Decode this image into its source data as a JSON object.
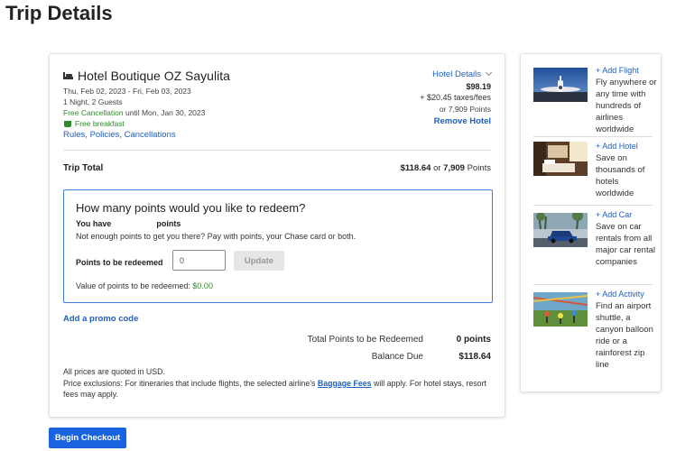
{
  "page": {
    "title": "Trip Details"
  },
  "hotel": {
    "name": "Hotel Boutique OZ Sayulita",
    "dates": "Thu, Feb 02, 2023 - Fri, Feb 03, 2023",
    "guests": "1 Night, 2 Guests",
    "free_cancel": "Free Cancellation",
    "cancel_until": " until Mon, Jan 30, 2023",
    "breakfast": "Free breakfast",
    "rules_link": "Rules, Policies, Cancellations",
    "details_link": "Hotel Details",
    "price": "$98.19",
    "taxes": "+ $20.45 taxes/fees",
    "points": "or 7,909 Points",
    "remove": "Remove Hotel"
  },
  "trip_total": {
    "label": "Trip Total",
    "amount": "$118.64",
    "or": " or ",
    "points": "7,909",
    "points_suffix": " Points"
  },
  "redeem": {
    "title": "How many points would you like to redeem?",
    "you_have": "You have",
    "points_word": "points",
    "not_enough": "Not enough points to get you there? Pay with points, your Chase card or both.",
    "input_label": "Points to be redeemed",
    "input_value": "0",
    "update_label": "Update",
    "value_label": "Value of points to be redeemed: ",
    "value_amount": "$0.00"
  },
  "promo": {
    "label": "Add a promo code"
  },
  "summary": {
    "points_label": "Total Points to be Redeemed",
    "points_value": "0 points",
    "balance_label": "Balance Due",
    "balance_value": "$118.64"
  },
  "footnote": {
    "line1": "All prices are quoted in USD.",
    "line2_pre": "Price exclusions: For itineraries that include flights, the selected airline's ",
    "baggage_link": "Baggage Fees",
    "line2_post": " will apply. For hotel stays, resort fees may apply."
  },
  "checkout": {
    "label": "Begin Checkout"
  },
  "sidebar": {
    "items": [
      {
        "link": "+ Add Flight",
        "desc": "Fly anywhere or any time with hundreds of airlines worldwide"
      },
      {
        "link": "+ Add Hotel",
        "desc": "Save on thousands of hotels worldwide"
      },
      {
        "link": "+ Add Car",
        "desc": "Save on car rentals from all major car rental companies"
      },
      {
        "link": "+ Add Activity",
        "desc": "Find an airport shuttle, a canyon balloon ride or a rainforest zip line"
      }
    ]
  },
  "colors": {
    "link": "#1e5fbf",
    "primary_button": "#1a63e0",
    "success": "#2e8b2e",
    "focus_border": "#3b7fd9"
  }
}
